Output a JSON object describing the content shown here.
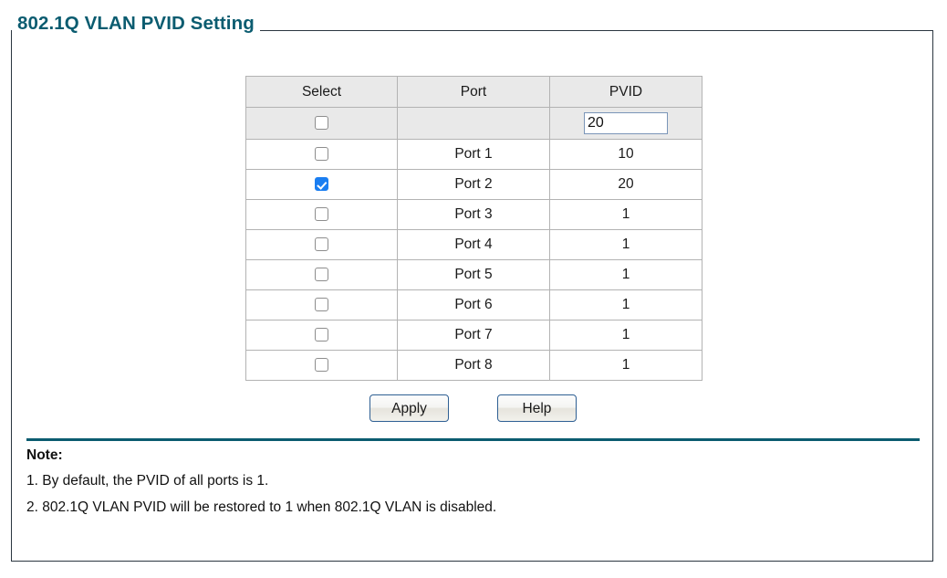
{
  "panel": {
    "legend": "802.1Q VLAN PVID Setting",
    "legend_color": "#0b5c70",
    "border_color": "#2b3640"
  },
  "table": {
    "headers": {
      "select": "Select",
      "port": "Port",
      "pvid": "PVID"
    },
    "control_row": {
      "select_all_checked": false,
      "pvid_value": "20",
      "pvid_placeholder": ""
    },
    "rows": [
      {
        "selected": false,
        "port": "Port 1",
        "pvid": "10"
      },
      {
        "selected": true,
        "port": "Port 2",
        "pvid": "20"
      },
      {
        "selected": false,
        "port": "Port 3",
        "pvid": "1"
      },
      {
        "selected": false,
        "port": "Port 4",
        "pvid": "1"
      },
      {
        "selected": false,
        "port": "Port 5",
        "pvid": "1"
      },
      {
        "selected": false,
        "port": "Port 6",
        "pvid": "1"
      },
      {
        "selected": false,
        "port": "Port 7",
        "pvid": "1"
      },
      {
        "selected": false,
        "port": "Port 8",
        "pvid": "1"
      }
    ]
  },
  "buttons": {
    "apply": "Apply",
    "help": "Help"
  },
  "note": {
    "title": "Note:",
    "rule_color": "#0b5c70",
    "lines": [
      "1. By default, the PVID of all ports is 1.",
      "2. 802.1Q VLAN PVID will be restored to 1 when 802.1Q VLAN is disabled."
    ]
  }
}
